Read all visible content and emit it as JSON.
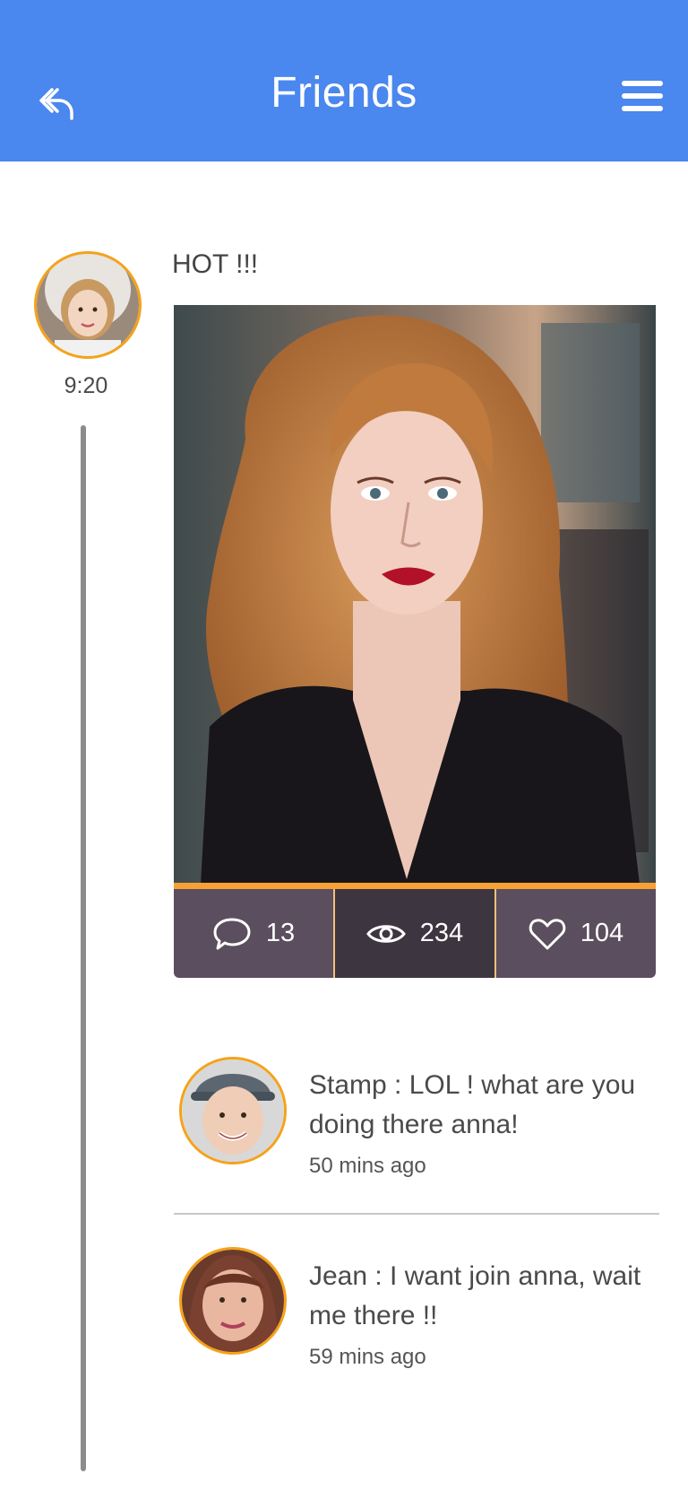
{
  "header": {
    "title": "Friends",
    "back_icon": "reply-arrow-icon",
    "menu_icon": "hamburger-menu-icon"
  },
  "post": {
    "time": "9:20",
    "text": "HOT !!!",
    "stats": {
      "comments": "13",
      "views": "234",
      "likes": "104"
    }
  },
  "comments": [
    {
      "author_text": "Stamp : LOL ! what are you doing there anna!",
      "time": "50 mins ago"
    },
    {
      "author_text": "Jean : I want join anna, wait me there !!",
      "time": "59 mins ago"
    }
  ],
  "colors": {
    "header_bg": "#4a87ee",
    "accent": "#f5a21a",
    "stats_bg": "#5b4e5e"
  }
}
